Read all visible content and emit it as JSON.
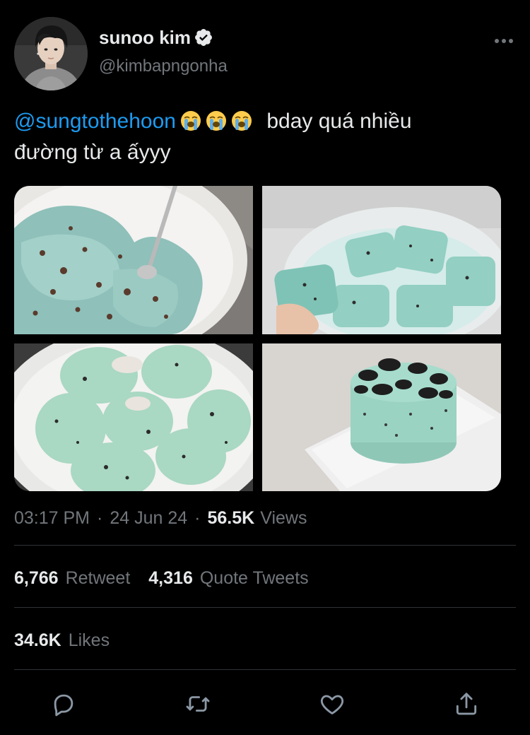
{
  "tweet": {
    "author": {
      "display_name": "sunoo kim",
      "handle": "@kimbapngonha",
      "verified": true
    },
    "text": {
      "mention": "@sungtothehoon",
      "emojis": [
        "😭",
        "😭",
        "😭"
      ],
      "line1_rest": "bday quá nhiều",
      "line2": "đường từ a ấyyy"
    },
    "meta": {
      "time": "03:17 PM",
      "separator": "·",
      "date": "24 Jun 24",
      "views_count": "56.5K",
      "views_label": "Views"
    },
    "stats": {
      "retweets_count": "6,766",
      "retweets_label": "Retweet",
      "quotes_count": "4,316",
      "quotes_label": "Quote Tweets",
      "likes_count": "34.6K",
      "likes_label": "Likes"
    },
    "media": [
      {
        "name": "mint-chip-ice-cream-bowl"
      },
      {
        "name": "mint-mochi-container"
      },
      {
        "name": "mint-mochi-plate"
      },
      {
        "name": "mint-oreo-cake"
      }
    ],
    "actions": [
      "reply-icon",
      "retweet-icon",
      "like-icon",
      "share-icon"
    ]
  },
  "colors": {
    "background": "#000000",
    "text_primary": "#e7e9ea",
    "text_secondary": "#71767b",
    "accent": "#1d9bf0",
    "divider": "#2f3336"
  }
}
